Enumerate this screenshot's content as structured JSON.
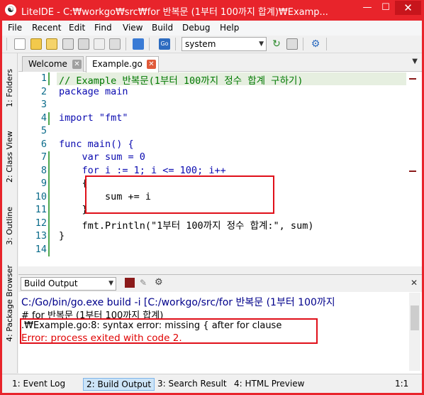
{
  "window": {
    "title": "LiteIDE - C:₩workgo₩src₩for 반복문 (1부터 100까지 합계)₩Examp...",
    "minimize": "—",
    "maximize": "☐",
    "close": "✕",
    "accent": "#e8242b"
  },
  "menu": [
    "File",
    "Recent",
    "Edit",
    "Find",
    "View",
    "Build",
    "Debug",
    "Help"
  ],
  "toolbar": {
    "env_value": "system"
  },
  "sidebar": [
    "1: Folders",
    "2: Class View",
    "3: Outline",
    "4: Package Browser"
  ],
  "tabs": [
    {
      "label": "Welcome"
    },
    {
      "label": "Example.go"
    }
  ],
  "editor": {
    "lines": [
      {
        "n": "1",
        "text": "// Example 반복문(1부터 100까지 정수 합계 구하기)"
      },
      {
        "n": "2",
        "text": "package main"
      },
      {
        "n": "3",
        "text": ""
      },
      {
        "n": "4",
        "text": "import \"fmt\""
      },
      {
        "n": "5",
        "text": ""
      },
      {
        "n": "6",
        "text": "func main() {"
      },
      {
        "n": "7",
        "text": "    var sum = 0"
      },
      {
        "n": "8",
        "text": "    for i := 1; i <= 100; i++"
      },
      {
        "n": "9",
        "text": "    {"
      },
      {
        "n": "10",
        "text": "        sum += i"
      },
      {
        "n": "11",
        "text": "    }"
      },
      {
        "n": "12",
        "text": "    fmt.Println(\"1부터 100까지 정수 합계:\", sum)"
      },
      {
        "n": "13",
        "text": "}"
      },
      {
        "n": "14",
        "text": ""
      }
    ]
  },
  "build_output": {
    "selector": "Build Output",
    "lines": [
      "C:/Go/bin/go.exe build -i [C:/workgo/src/for 반복문 (1부터 100까지",
      "# for 반복문 (1부터 100까지 합계)",
      ".₩Example.go:8: syntax error: missing { after for clause",
      "Error: process exited with code 2."
    ]
  },
  "status_tabs": [
    "1: Event Log",
    "2: Build Output",
    "3: Search Result",
    "4: HTML Preview"
  ],
  "status_position": "1:1"
}
